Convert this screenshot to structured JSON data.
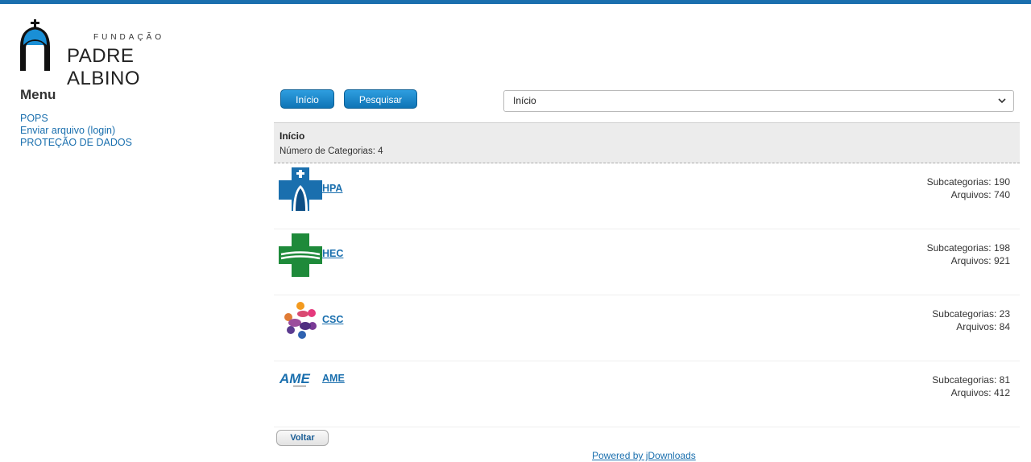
{
  "header": {
    "logo_small": "FUNDAÇÃO",
    "logo_big": "PADRE ALBINO",
    "accent": "#1a6fae"
  },
  "sidebar": {
    "title": "Menu",
    "items": [
      {
        "label": "POPS"
      },
      {
        "label": "Enviar arquivo (login)"
      },
      {
        "label": "PROTEÇÃO DE DADOS"
      }
    ]
  },
  "toolbar": {
    "inicio_label": "Início",
    "pesquisar_label": "Pesquisar",
    "select_value": "Início"
  },
  "category_header": {
    "title": "Início",
    "count_text": "Número de Categorias: 4"
  },
  "categories": [
    {
      "name": "HPA",
      "subcategorias": "Subcategorias: 190",
      "arquivos": "Arquivos: 740",
      "icon": "hpa-logo-icon"
    },
    {
      "name": "HEC",
      "subcategorias": "Subcategorias: 198",
      "arquivos": "Arquivos: 921",
      "icon": "hec-logo-icon"
    },
    {
      "name": "CSC",
      "subcategorias": "Subcategorias: 23",
      "arquivos": "Arquivos: 84",
      "icon": "csc-logo-icon"
    },
    {
      "name": "AME",
      "subcategorias": "Subcategorias: 81",
      "arquivos": "Arquivos: 412",
      "icon": "ame-logo-icon"
    }
  ],
  "footer": {
    "voltar_label": "Voltar",
    "powered_text": "Powered by jDownloads"
  }
}
